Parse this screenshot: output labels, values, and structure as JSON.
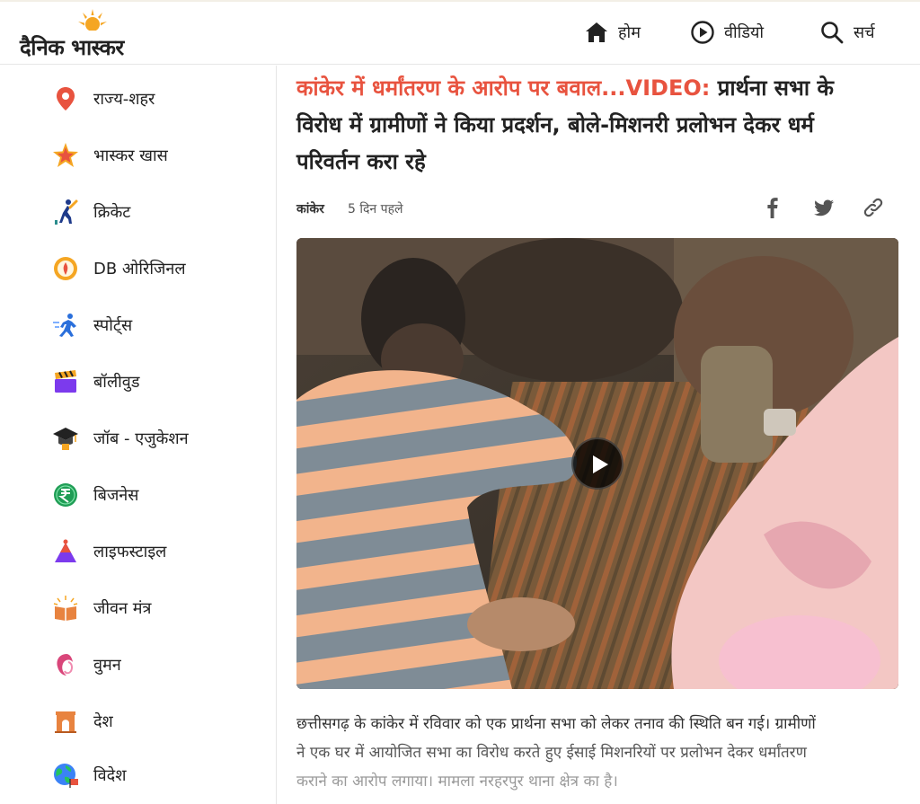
{
  "header": {
    "logo_text": "दैनिक भास्कर",
    "nav": {
      "home": "होम",
      "video": "वीडियो",
      "search": "सर्च"
    }
  },
  "sidebar": {
    "items": [
      {
        "label": "राज्य-शहर",
        "icon": "location-pin-icon"
      },
      {
        "label": "भास्कर खास",
        "icon": "star-icon"
      },
      {
        "label": "क्रिकेट",
        "icon": "cricket-icon"
      },
      {
        "label": "DB ओरिजिनल",
        "icon": "db-original-icon"
      },
      {
        "label": "स्पोर्ट्स",
        "icon": "runner-icon"
      },
      {
        "label": "बॉलीवुड",
        "icon": "clapperboard-icon"
      },
      {
        "label": "जॉब - एजुकेशन",
        "icon": "graduation-cap-icon"
      },
      {
        "label": "बिजनेस",
        "icon": "rupee-icon"
      },
      {
        "label": "लाइफस्टाइल",
        "icon": "lifestyle-icon"
      },
      {
        "label": "जीवन मंत्र",
        "icon": "book-icon"
      },
      {
        "label": "वुमन",
        "icon": "woman-icon"
      },
      {
        "label": "देश",
        "icon": "india-gate-icon"
      },
      {
        "label": "विदेश",
        "icon": "globe-icon"
      }
    ]
  },
  "article": {
    "kicker": "कांकेर में धर्मांतरण के आरोप पर बवाल...VIDEO:",
    "headline": " प्रार्थना सभा के विरोध में ग्रामीणों ने किया प्रदर्शन, बोले-मिशनरी प्रलोभन देकर धर्म परिवर्तन करा रहे",
    "location": "कांकेर",
    "time": "5 दिन पहले",
    "summary_line1": "छत्तीसगढ़ के कांकेर में रविवार को एक प्रार्थना सभा को लेकर तनाव की स्थिति बन गई। ग्रामीणों",
    "summary_line2": "ने एक घर में आयोजित सभा का विरोध करते हुए ईसाई मिशनरियों पर प्रलोभन देकर धर्मांतरण",
    "summary_line3": "कराने का आरोप लगाया। मामला नरहरपुर थाना क्षेत्र का है।"
  },
  "colors": {
    "accent": "#e8533f",
    "logo_sun": "#f5a623",
    "text": "#222222"
  }
}
